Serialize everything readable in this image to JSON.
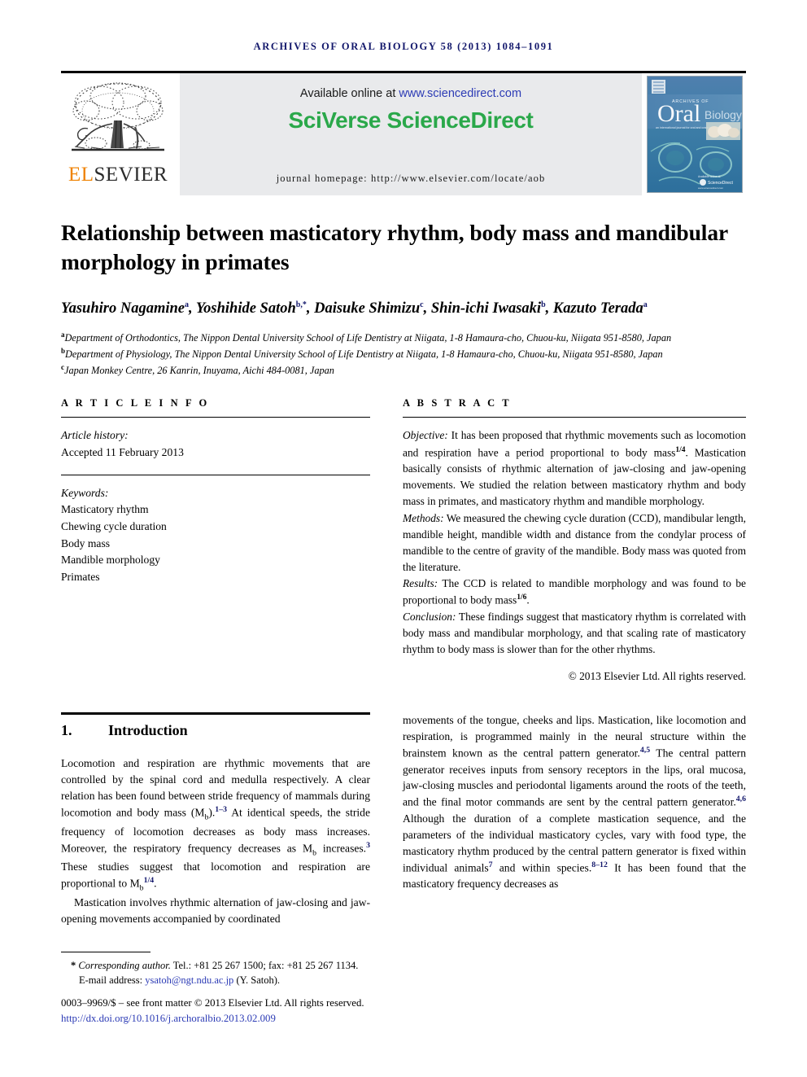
{
  "running_head": "ARCHIVES OF ORAL BIOLOGY 58 (2013) 1084–1091",
  "masthead": {
    "publisher_el": "EL",
    "publisher_sevier": "SEVIER",
    "available_text": "Available online at ",
    "available_url": "www.sciencedirect.com",
    "sciencedirect_logo": "SciVerse ScienceDirect",
    "journal_homepage": "journal homepage: http://www.elsevier.com/locate/aob",
    "cover": {
      "line1": "ARCHIVES OF",
      "line2": "Oral",
      "line3": "Biology",
      "subtitle": "an international journal for oral and craniofacial biosciences",
      "footer_logo": "ScienceDirect"
    }
  },
  "title": "Relationship between masticatory rhythm, body mass and mandibular morphology in primates",
  "authors": [
    {
      "name": "Yasuhiro Nagamine",
      "marks": "a",
      "sep": ", "
    },
    {
      "name": "Yoshihide Satoh",
      "marks": "b,*",
      "sep": ", "
    },
    {
      "name": "Daisuke Shimizu",
      "marks": "c",
      "sep": ", "
    },
    {
      "name": "Shin-ichi Iwasaki",
      "marks": "b",
      "sep": ", "
    },
    {
      "name": "Kazuto Terada",
      "marks": "a",
      "sep": ""
    }
  ],
  "affiliations": [
    {
      "mark": "a",
      "text": "Department of Orthodontics, The Nippon Dental University School of Life Dentistry at Niigata, 1-8 Hamaura-cho, Chuou-ku, Niigata 951-8580, Japan"
    },
    {
      "mark": "b",
      "text": "Department of Physiology, The Nippon Dental University School of Life Dentistry at Niigata, 1-8 Hamaura-cho, Chuou-ku, Niigata 951-8580, Japan"
    },
    {
      "mark": "c",
      "text": "Japan Monkey Centre, 26 Kanrin, Inuyama, Aichi 484-0081, Japan"
    }
  ],
  "article_info": {
    "heading": "A R T I C L E   I N F O",
    "history_label": "Article history:",
    "history_value": "Accepted 11 February 2013",
    "keywords_label": "Keywords:",
    "keywords": [
      "Masticatory rhythm",
      "Chewing cycle duration",
      "Body mass",
      "Mandible morphology",
      "Primates"
    ]
  },
  "abstract": {
    "heading": "A B S T R A C T",
    "objective_label": "Objective:",
    "objective_text_1": " It has been proposed that rhythmic movements such as locomotion and respiration have a period proportional to body mass",
    "objective_sup_1": "1/4",
    "objective_text_2": ". Mastication basically consists of rhythmic alternation of jaw-closing and jaw-opening movements. We studied the relation between masticatory rhythm and body mass in primates, and masticatory rhythm and mandible morphology.",
    "methods_label": "Methods:",
    "methods_text": " We measured the chewing cycle duration (CCD), mandibular length, mandible height, mandible width and distance from the condylar process of mandible to the centre of gravity of the mandible. Body mass was quoted from the literature.",
    "results_label": "Results:",
    "results_text_1": " The CCD is related to mandible morphology and was found to be proportional to body mass",
    "results_sup": "1/6",
    "results_text_2": ".",
    "conclusion_label": "Conclusion:",
    "conclusion_text": " These findings suggest that masticatory rhythm is correlated with body mass and mandibular morphology, and that scaling rate of masticatory rhythm to body mass is slower than for the other rhythms.",
    "copyright": "© 2013 Elsevier Ltd. All rights reserved."
  },
  "introduction": {
    "number": "1.",
    "title": "Introduction",
    "p1_a": "Locomotion and respiration are rhythmic movements that are controlled by the spinal cord and medulla respectively. A clear relation has been found between stride frequency of mammals during locomotion and body mass (M",
    "p1_sub": "b",
    "p1_b": ").",
    "p1_cite1": "1–3",
    "p1_c": " At identical speeds, the stride frequency of locomotion decreases as body mass increases. Moreover, the respiratory frequency decreases as M",
    "p1_sub2": "b",
    "p1_d": " increases.",
    "p1_cite2": "3",
    "p1_e": " These studies suggest that locomotion and respiration are proportional to M",
    "p1_sub3": "b",
    "p1_sup_frac": "1/4",
    "p1_f": ".",
    "p2_a": "Mastication involves rhythmic alternation of jaw-closing and jaw-opening movements accompanied by coordinated",
    "r1_a": "movements of the tongue, cheeks and lips. Mastication, like locomotion and respiration, is programmed mainly in the neural structure within the brainstem known as the central pattern generator.",
    "r1_cite1": "4,5",
    "r1_b": " The central pattern generator receives inputs from sensory receptors in the lips, oral mucosa, jaw-closing muscles and periodontal ligaments around the roots of the teeth, and the final motor commands are sent by the central pattern generator.",
    "r1_cite2": "4,6",
    "r1_c": " Although the duration of a complete mastication sequence, and the parameters of the individual masticatory cycles, vary with food type, the masticatory rhythm produced by the central pattern generator is fixed within individual animals",
    "r1_cite3": "7",
    "r1_d": " and within species.",
    "r1_cite4": "8–12",
    "r1_e": " It has been found that the masticatory frequency decreases as"
  },
  "footer": {
    "star": "*",
    "corr_label": "Corresponding author.",
    "corr_text": " Tel.: +81 25 267 1500; fax: +81 25 267 1134.",
    "email_label": "E-mail address: ",
    "email": "ysatoh@ngt.ndu.ac.jp",
    "email_suffix": " (Y. Satoh).",
    "issn": "0003–9969/$ – see front matter © 2013 Elsevier Ltd. All rights reserved.",
    "doi": "http://dx.doi.org/10.1016/j.archoralbio.2013.02.009"
  },
  "colors": {
    "header_blue": "#12176b",
    "link_blue": "#2c3bb5",
    "sciencedirect_green": "#2aa84a",
    "elsevier_orange": "#ef8200",
    "banner_grey": "#e9eaec"
  }
}
